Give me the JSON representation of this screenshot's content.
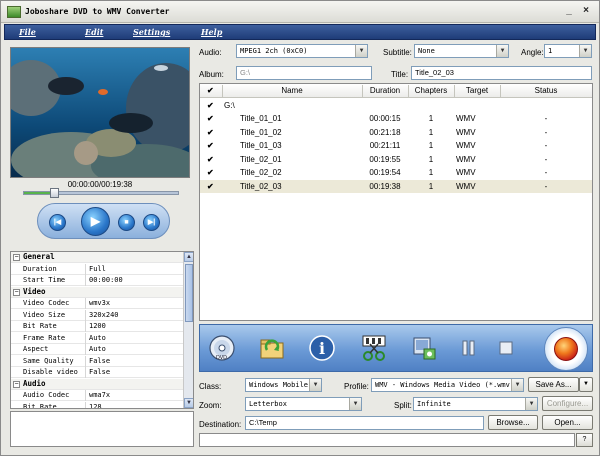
{
  "window": {
    "title": "Joboshare DVD to WMV Converter"
  },
  "menu": [
    "File",
    "Edit",
    "Settings",
    "Help"
  ],
  "player": {
    "time": "00:00:00/00:19:38",
    "seek_progress": 0.19
  },
  "properties": [
    {
      "type": "group",
      "label": "General"
    },
    {
      "key": "Duration",
      "value": "Full"
    },
    {
      "key": "Start Time",
      "value": "00:00:00"
    },
    {
      "type": "group",
      "label": "Video"
    },
    {
      "key": "Video Codec",
      "value": "wmv3x"
    },
    {
      "key": "Video Size",
      "value": "320x240"
    },
    {
      "key": "Bit Rate",
      "value": "1200"
    },
    {
      "key": "Frame Rate",
      "value": "Auto"
    },
    {
      "key": "Aspect",
      "value": "Auto"
    },
    {
      "key": "Same Quality",
      "value": "False"
    },
    {
      "key": "Disable video",
      "value": "False"
    },
    {
      "type": "group",
      "label": "Audio"
    },
    {
      "key": "Audio Codec",
      "value": "wma7x"
    },
    {
      "key": "Bit Rate",
      "value": "128"
    }
  ],
  "source": {
    "audio_label": "Audio:",
    "audio_value": "MPEG1 2ch (0xC0)",
    "subtitle_label": "Subtitle:",
    "subtitle_value": "None",
    "angle_label": "Angle:",
    "angle_value": "1",
    "album_label": "Album:",
    "album_value": "G:\\",
    "title_label": "Title:",
    "title_value": "Title_02_03"
  },
  "table": {
    "columns": [
      "Name",
      "Duration",
      "Chapters",
      "Target",
      "Status"
    ],
    "root": "G:\\",
    "rows": [
      {
        "name": "Title_01_01",
        "duration": "00:00:15",
        "chapters": "1",
        "target": "WMV",
        "status": "-"
      },
      {
        "name": "Title_01_02",
        "duration": "00:21:18",
        "chapters": "1",
        "target": "WMV",
        "status": "-"
      },
      {
        "name": "Title_01_03",
        "duration": "00:21:11",
        "chapters": "1",
        "target": "WMV",
        "status": "-"
      },
      {
        "name": "Title_02_01",
        "duration": "00:19:55",
        "chapters": "1",
        "target": "WMV",
        "status": "-"
      },
      {
        "name": "Title_02_02",
        "duration": "00:19:54",
        "chapters": "1",
        "target": "WMV",
        "status": "-"
      },
      {
        "name": "Title_02_03",
        "duration": "00:19:38",
        "chapters": "1",
        "target": "WMV",
        "status": "-"
      }
    ]
  },
  "output": {
    "class_label": "Class:",
    "class_value": "Windows Mobile",
    "profile_label": "Profile:",
    "profile_value": "WMV - Windows Media Video  (*.wmv)",
    "save_as": "Save As...",
    "zoom_label": "Zoom:",
    "zoom_value": "Letterbox",
    "split_label": "Split:",
    "split_value": "Infinite",
    "configure": "Configure...",
    "destination_label": "Destination:",
    "destination_value": "C:\\Temp",
    "browse": "Browse...",
    "open": "Open..."
  },
  "help_label": "?"
}
